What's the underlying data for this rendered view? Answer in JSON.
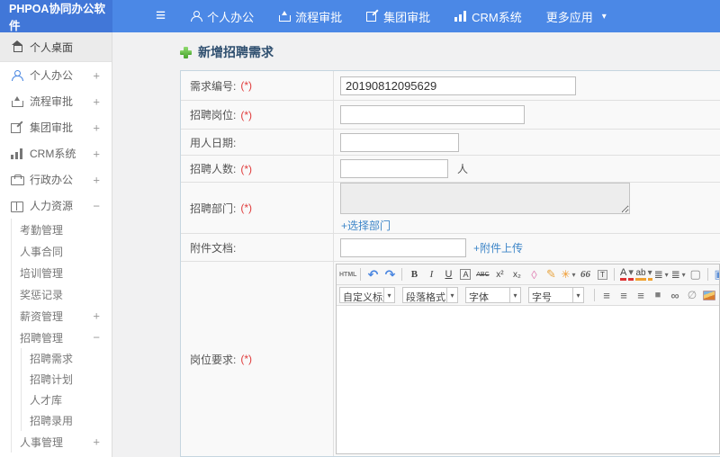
{
  "header": {
    "brand": "PHPOA协同办公软件",
    "menu_icon": "≡",
    "nav": [
      {
        "label": "个人办公"
      },
      {
        "label": "流程审批"
      },
      {
        "label": "集团审批"
      },
      {
        "label": "CRM系统"
      },
      {
        "label": "更多应用",
        "caret": "▾"
      }
    ]
  },
  "sidebar": {
    "items": [
      {
        "label": "个人桌面"
      },
      {
        "label": "个人办公",
        "toggle": "+"
      },
      {
        "label": "流程审批",
        "toggle": "+"
      },
      {
        "label": "集团审批",
        "toggle": "+"
      },
      {
        "label": "CRM系统",
        "toggle": "+"
      },
      {
        "label": "行政办公",
        "toggle": "+"
      },
      {
        "label": "人力资源",
        "toggle": "−"
      },
      {
        "label": "考勤管理"
      },
      {
        "label": "人事合同"
      },
      {
        "label": "培训管理"
      },
      {
        "label": "奖惩记录"
      },
      {
        "label": "薪资管理",
        "toggle": "+"
      },
      {
        "label": "招聘管理",
        "toggle": "−"
      },
      {
        "label": "招聘需求"
      },
      {
        "label": "招聘计划"
      },
      {
        "label": "人才库"
      },
      {
        "label": "招聘录用"
      },
      {
        "label": "人事管理",
        "toggle": "+"
      }
    ]
  },
  "main": {
    "title": "新增招聘需求",
    "form": {
      "rows": [
        {
          "label": "需求编号:",
          "required": "(*)",
          "value": "20190812095629"
        },
        {
          "label": "招聘岗位:",
          "required": "(*)",
          "value": ""
        },
        {
          "label": "用人日期:",
          "required": "",
          "value": ""
        },
        {
          "label": "招聘人数:",
          "required": "(*)",
          "value": "",
          "suffix": "人"
        },
        {
          "label": "招聘部门:",
          "required": "(*)",
          "link": "+选择部门"
        },
        {
          "label": "附件文档:",
          "required": "",
          "value": "",
          "link": "+附件上传"
        },
        {
          "label": "岗位要求:",
          "required": "(*)"
        }
      ]
    },
    "editor": {
      "toolbar1": [
        {
          "glyph": "HTML"
        },
        {
          "glyph": "↶"
        },
        {
          "glyph": "↷"
        },
        {
          "glyph": "B"
        },
        {
          "glyph": "I"
        },
        {
          "glyph": "U"
        },
        {
          "glyph": "A"
        },
        {
          "glyph": "ABC"
        },
        {
          "glyph": "x²"
        },
        {
          "glyph": "x₂"
        },
        {
          "glyph": "◊"
        },
        {
          "glyph": "✎"
        },
        {
          "glyph": "✳"
        },
        {
          "glyph": "66"
        },
        {
          "glyph": "T"
        },
        {
          "glyph": "A"
        },
        {
          "glyph": "ab"
        },
        {
          "glyph": "≣"
        },
        {
          "glyph": "≣"
        },
        {
          "glyph": "▢"
        },
        {
          "glyph": "▣"
        }
      ],
      "toolbar2_selects": [
        {
          "value": "自定义标题"
        },
        {
          "value": "段落格式"
        },
        {
          "value": "字体"
        },
        {
          "value": "字号"
        }
      ],
      "toolbar2_icons": [
        {
          "glyph": "≡"
        },
        {
          "glyph": "≡"
        },
        {
          "glyph": "≡"
        },
        {
          "glyph": "■"
        },
        {
          "glyph": "∞"
        },
        {
          "glyph": "∅"
        },
        {
          "glyph": ""
        },
        {
          "glyph": ""
        },
        {
          "glyph": ""
        },
        {
          "glyph": "▦"
        }
      ],
      "caret": "▾"
    }
  },
  "colors": {
    "header_blue": "#4b88e6",
    "logo_blue": "#4177d8",
    "link_blue": "#3e86c8",
    "required_red": "#e03c3c",
    "plus_green": "#4aa52f"
  }
}
